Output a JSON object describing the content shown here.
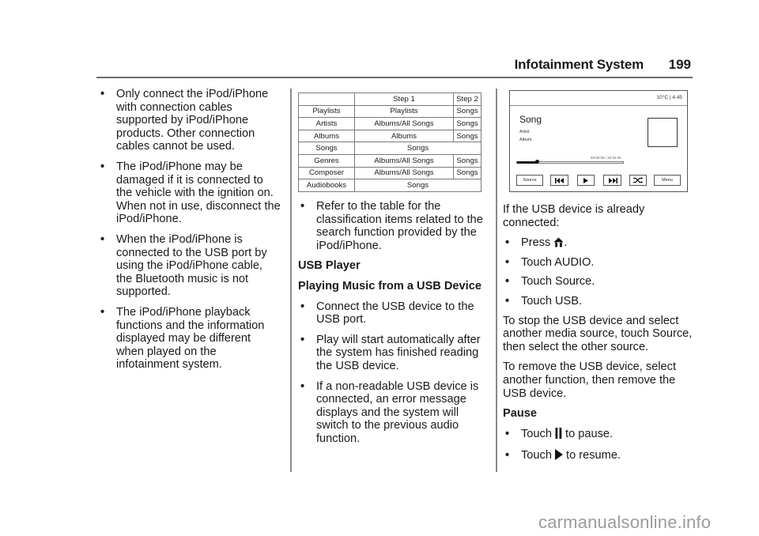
{
  "header": {
    "title": "Infotainment System",
    "page_number": "199"
  },
  "left_column": {
    "bullets": [
      "Only connect the iPod/iPhone with connection cables supported by iPod/iPhone products. Other connection cables cannot be used.",
      "The iPod/iPhone may be damaged if it is connected to the vehicle with the ignition on. When not in use, disconnect the iPod/iPhone.",
      "When the iPod/iPhone is connected to the USB port by using the iPod/iPhone cable, the Bluetooth music is not supported.",
      "The iPod/iPhone playback functions and the information displayed may be different when played on the infotainment system."
    ]
  },
  "classification_table": {
    "headers": [
      "",
      "Step 1",
      "Step 2"
    ],
    "rows": [
      {
        "category": "Playlists",
        "step1": "Playlists",
        "step2": "Songs"
      },
      {
        "category": "Artists",
        "step1": "Albums/All Songs",
        "step2": "Songs"
      },
      {
        "category": "Albums",
        "step1": "Albums",
        "step2": "Songs"
      },
      {
        "category": "Songs",
        "step1": "Songs",
        "step2": null
      },
      {
        "category": "Genres",
        "step1": "Albums/All Songs",
        "step2": "Songs"
      },
      {
        "category": "Composer",
        "step1": "Albums/All Songs",
        "step2": "Songs"
      },
      {
        "category": "Audiobooks",
        "step1": "Songs",
        "step2": null
      }
    ]
  },
  "middle_column": {
    "table_note": "Refer to the table for the classification items related to the search function provided by the iPod/iPhone.",
    "section_heading": "USB Player",
    "subsection_heading": "Playing Music from a USB Device",
    "bullets": [
      "Connect the USB device to the USB port.",
      "Play will start automatically after the system has finished reading the USB device.",
      "If a non-readable USB device is connected, an error message displays and the system will switch to the previous audio function."
    ]
  },
  "device_screen": {
    "status": "10°C | 4:45",
    "song": "Song",
    "artist": "Artist",
    "album": "Album",
    "time": "03:00:26 / 32:31:32",
    "progress_fraction": 0.19,
    "buttons": {
      "source": "Source",
      "previous": "previous-track-icon",
      "play": "play-icon",
      "next": "next-track-icon",
      "shuffle": "shuffle-icon",
      "menu": "Menu"
    }
  },
  "right_column": {
    "intro": "If the USB device is already connected:",
    "steps": [
      {
        "prefix": "Press ",
        "icon": "home-icon",
        "suffix": "."
      },
      {
        "text": "Touch AUDIO."
      },
      {
        "text": "Touch Source."
      },
      {
        "text": "Touch USB."
      }
    ],
    "stop_paragraph": "To stop the USB device and select another media source, touch Source, then select the other source.",
    "remove_paragraph": "To remove the USB device, select another function, then remove the USB device.",
    "pause_heading": "Pause",
    "pause_steps": [
      {
        "prefix": "Touch ",
        "icon": "pause-icon",
        "suffix": " to pause."
      },
      {
        "prefix": "Touch ",
        "icon": "play-icon",
        "suffix": " to resume."
      }
    ]
  },
  "bullet_glyph": "•",
  "watermark": "carmanualsonline.info"
}
